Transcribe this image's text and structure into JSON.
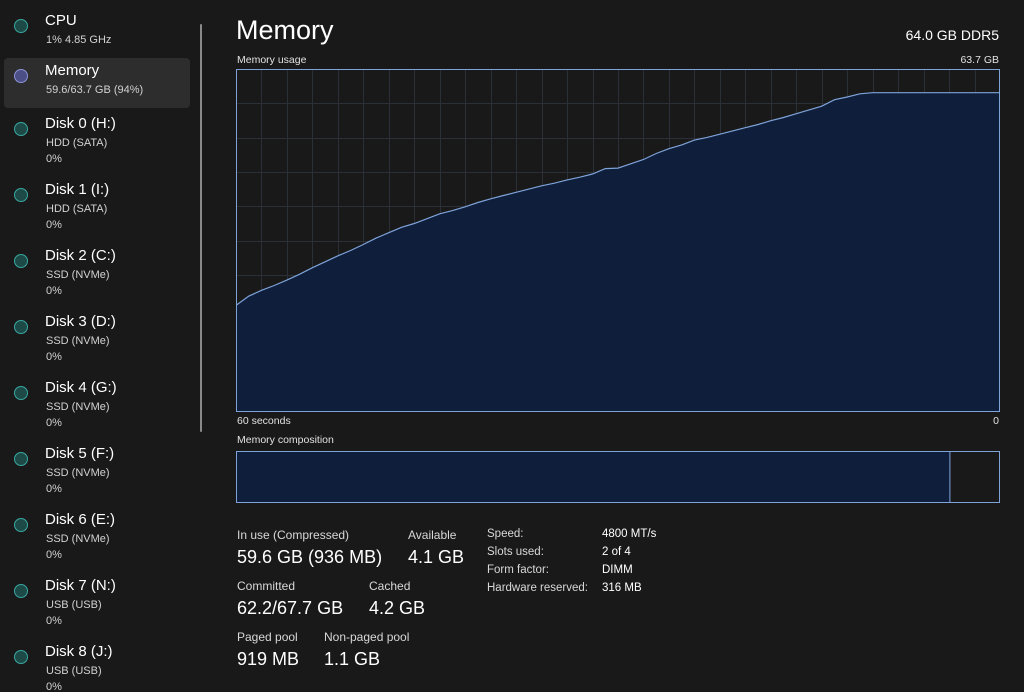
{
  "sidebar": {
    "items": [
      {
        "title": "CPU",
        "sub1": "1%  4.85 GHz",
        "sub2": ""
      },
      {
        "title": "Memory",
        "sub1": "59.6/63.7 GB (94%)",
        "sub2": ""
      },
      {
        "title": "Disk 0 (H:)",
        "sub1": "HDD (SATA)",
        "sub2": "0%"
      },
      {
        "title": "Disk 1 (I:)",
        "sub1": "HDD (SATA)",
        "sub2": "0%"
      },
      {
        "title": "Disk 2 (C:)",
        "sub1": "SSD (NVMe)",
        "sub2": "0%"
      },
      {
        "title": "Disk 3 (D:)",
        "sub1": "SSD (NVMe)",
        "sub2": "0%"
      },
      {
        "title": "Disk 4 (G:)",
        "sub1": "SSD (NVMe)",
        "sub2": "0%"
      },
      {
        "title": "Disk 5 (F:)",
        "sub1": "SSD (NVMe)",
        "sub2": "0%"
      },
      {
        "title": "Disk 6 (E:)",
        "sub1": "SSD (NVMe)",
        "sub2": "0%"
      },
      {
        "title": "Disk 7 (N:)",
        "sub1": "USB (USB)",
        "sub2": "0%"
      },
      {
        "title": "Disk 8 (J:)",
        "sub1": "USB (USB)",
        "sub2": "0%"
      }
    ],
    "selected_index": 1
  },
  "header": {
    "title": "Memory",
    "summary": "64.0 GB DDR5"
  },
  "usage_chart": {
    "label": "Memory usage",
    "max_label": "63.7 GB",
    "x_left_label": "60 seconds",
    "x_right_label": "0",
    "max_value": 63.7,
    "seconds": 60,
    "values_gb": [
      19.8,
      21.5,
      22.6,
      23.5,
      24.5,
      25.6,
      26.8,
      27.9,
      29.0,
      30.0,
      31.1,
      32.3,
      33.3,
      34.3,
      35.0,
      35.9,
      36.8,
      37.4,
      38.1,
      38.9,
      39.6,
      40.2,
      40.8,
      41.4,
      42.0,
      42.5,
      43.1,
      43.6,
      44.2,
      45.2,
      45.3,
      46.1,
      46.9,
      48.0,
      48.9,
      49.6,
      50.5,
      51.0,
      51.6,
      52.2,
      52.8,
      53.4,
      54.1,
      54.7,
      55.4,
      56.1,
      56.8,
      58.0,
      58.5,
      59.1,
      59.3,
      59.3,
      59.3,
      59.3,
      59.3,
      59.3,
      59.3,
      59.3,
      59.3,
      59.3,
      59.3
    ],
    "colors": {
      "fill": "#0f1e3b",
      "line": "#7ea3d9",
      "grid": "#2b2f38",
      "border": "#7ea3d9"
    }
  },
  "composition": {
    "label": "Memory composition",
    "in_use_fraction": 0.935,
    "colors": {
      "in_use": "#0f1e3b",
      "border": "#7ea3d9",
      "free": "#191919"
    }
  },
  "stats": {
    "in_use_label": "In use (Compressed)",
    "in_use_value": "59.6 GB (936 MB)",
    "available_label": "Available",
    "available_value": "4.1 GB",
    "committed_label": "Committed",
    "committed_value": "62.2/67.7 GB",
    "cached_label": "Cached",
    "cached_value": "4.2 GB",
    "paged_label": "Paged pool",
    "paged_value": "919 MB",
    "nonpaged_label": "Non-paged pool",
    "nonpaged_value": "1.1 GB"
  },
  "specs": {
    "speed_label": "Speed:",
    "speed_value": "4800 MT/s",
    "slots_label": "Slots used:",
    "slots_value": "2 of 4",
    "form_label": "Form factor:",
    "form_value": "DIMM",
    "reserved_label": "Hardware reserved:",
    "reserved_value": "316 MB"
  }
}
